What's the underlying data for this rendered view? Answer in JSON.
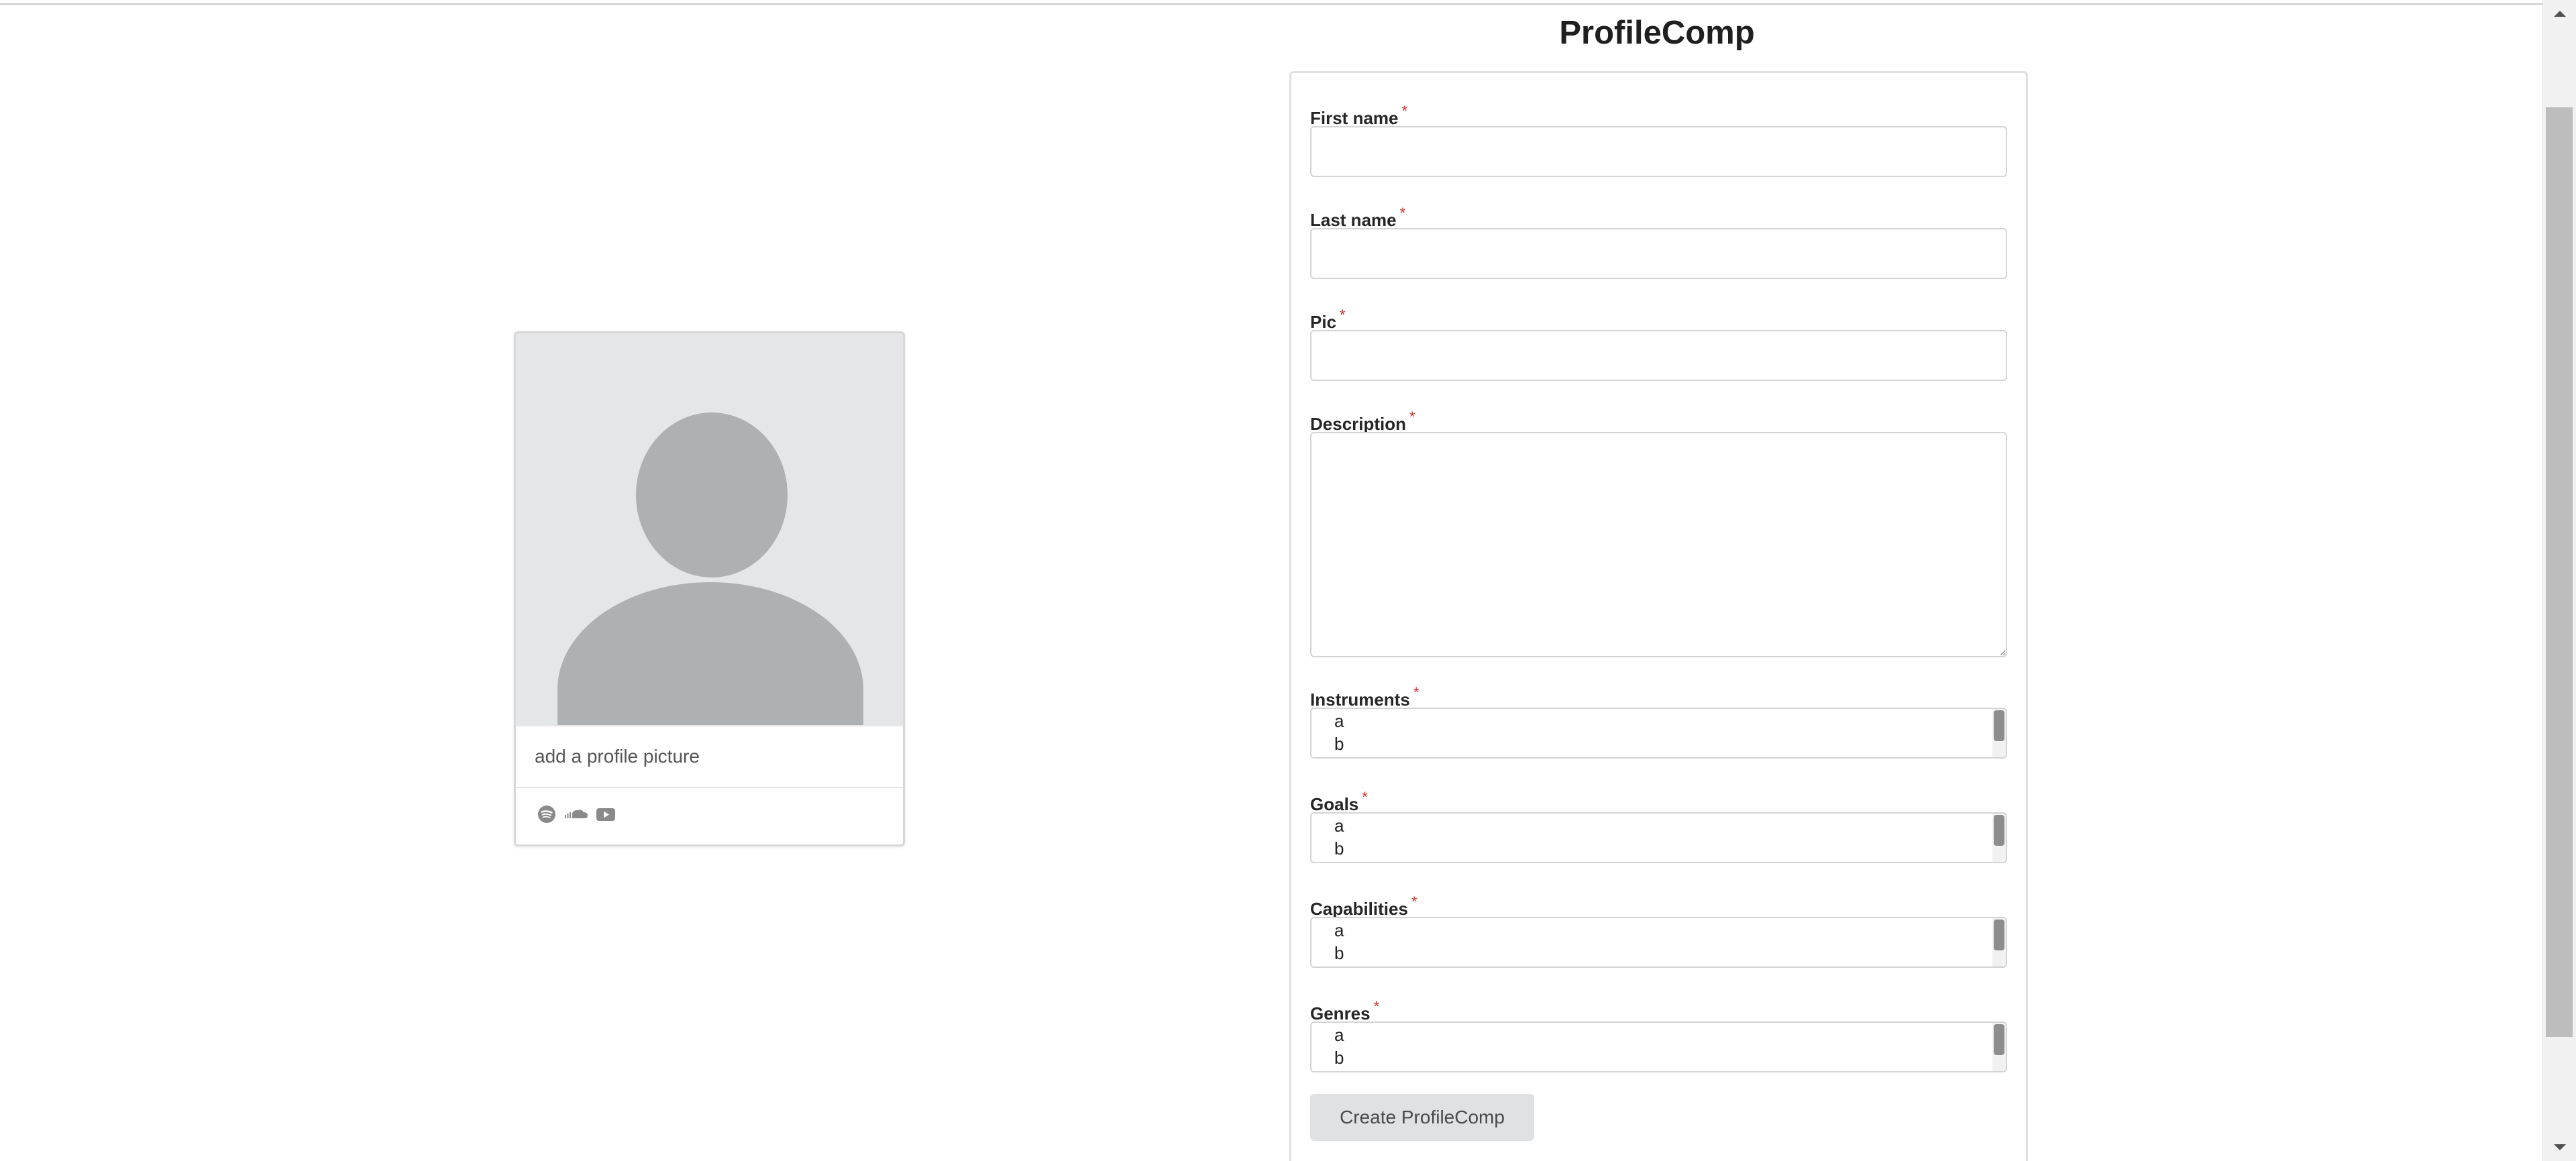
{
  "page": {
    "title": "ProfileComp"
  },
  "card": {
    "caption": "add a profile picture",
    "icons": [
      "spotify-icon",
      "soundcloud-icon",
      "youtube-icon"
    ]
  },
  "form": {
    "required_marker": "*",
    "fields": {
      "first_name": {
        "label": "First name",
        "value": ""
      },
      "last_name": {
        "label": "Last name",
        "value": ""
      },
      "pic": {
        "label": "Pic",
        "value": ""
      },
      "description": {
        "label": "Description",
        "value": ""
      },
      "instruments": {
        "label": "Instruments",
        "options": [
          "a",
          "b"
        ]
      },
      "goals": {
        "label": "Goals",
        "options": [
          "a",
          "b"
        ]
      },
      "capabilities": {
        "label": "Capabilities",
        "options": [
          "a",
          "b"
        ]
      },
      "genres": {
        "label": "Genres",
        "options": [
          "a",
          "b"
        ]
      }
    },
    "submit_label": "Create ProfileComp"
  },
  "colors": {
    "required": "#d93025",
    "avatar_bg": "#e5e6e7",
    "avatar_fg": "#adb1b4",
    "button_bg": "#e0e1e2"
  }
}
